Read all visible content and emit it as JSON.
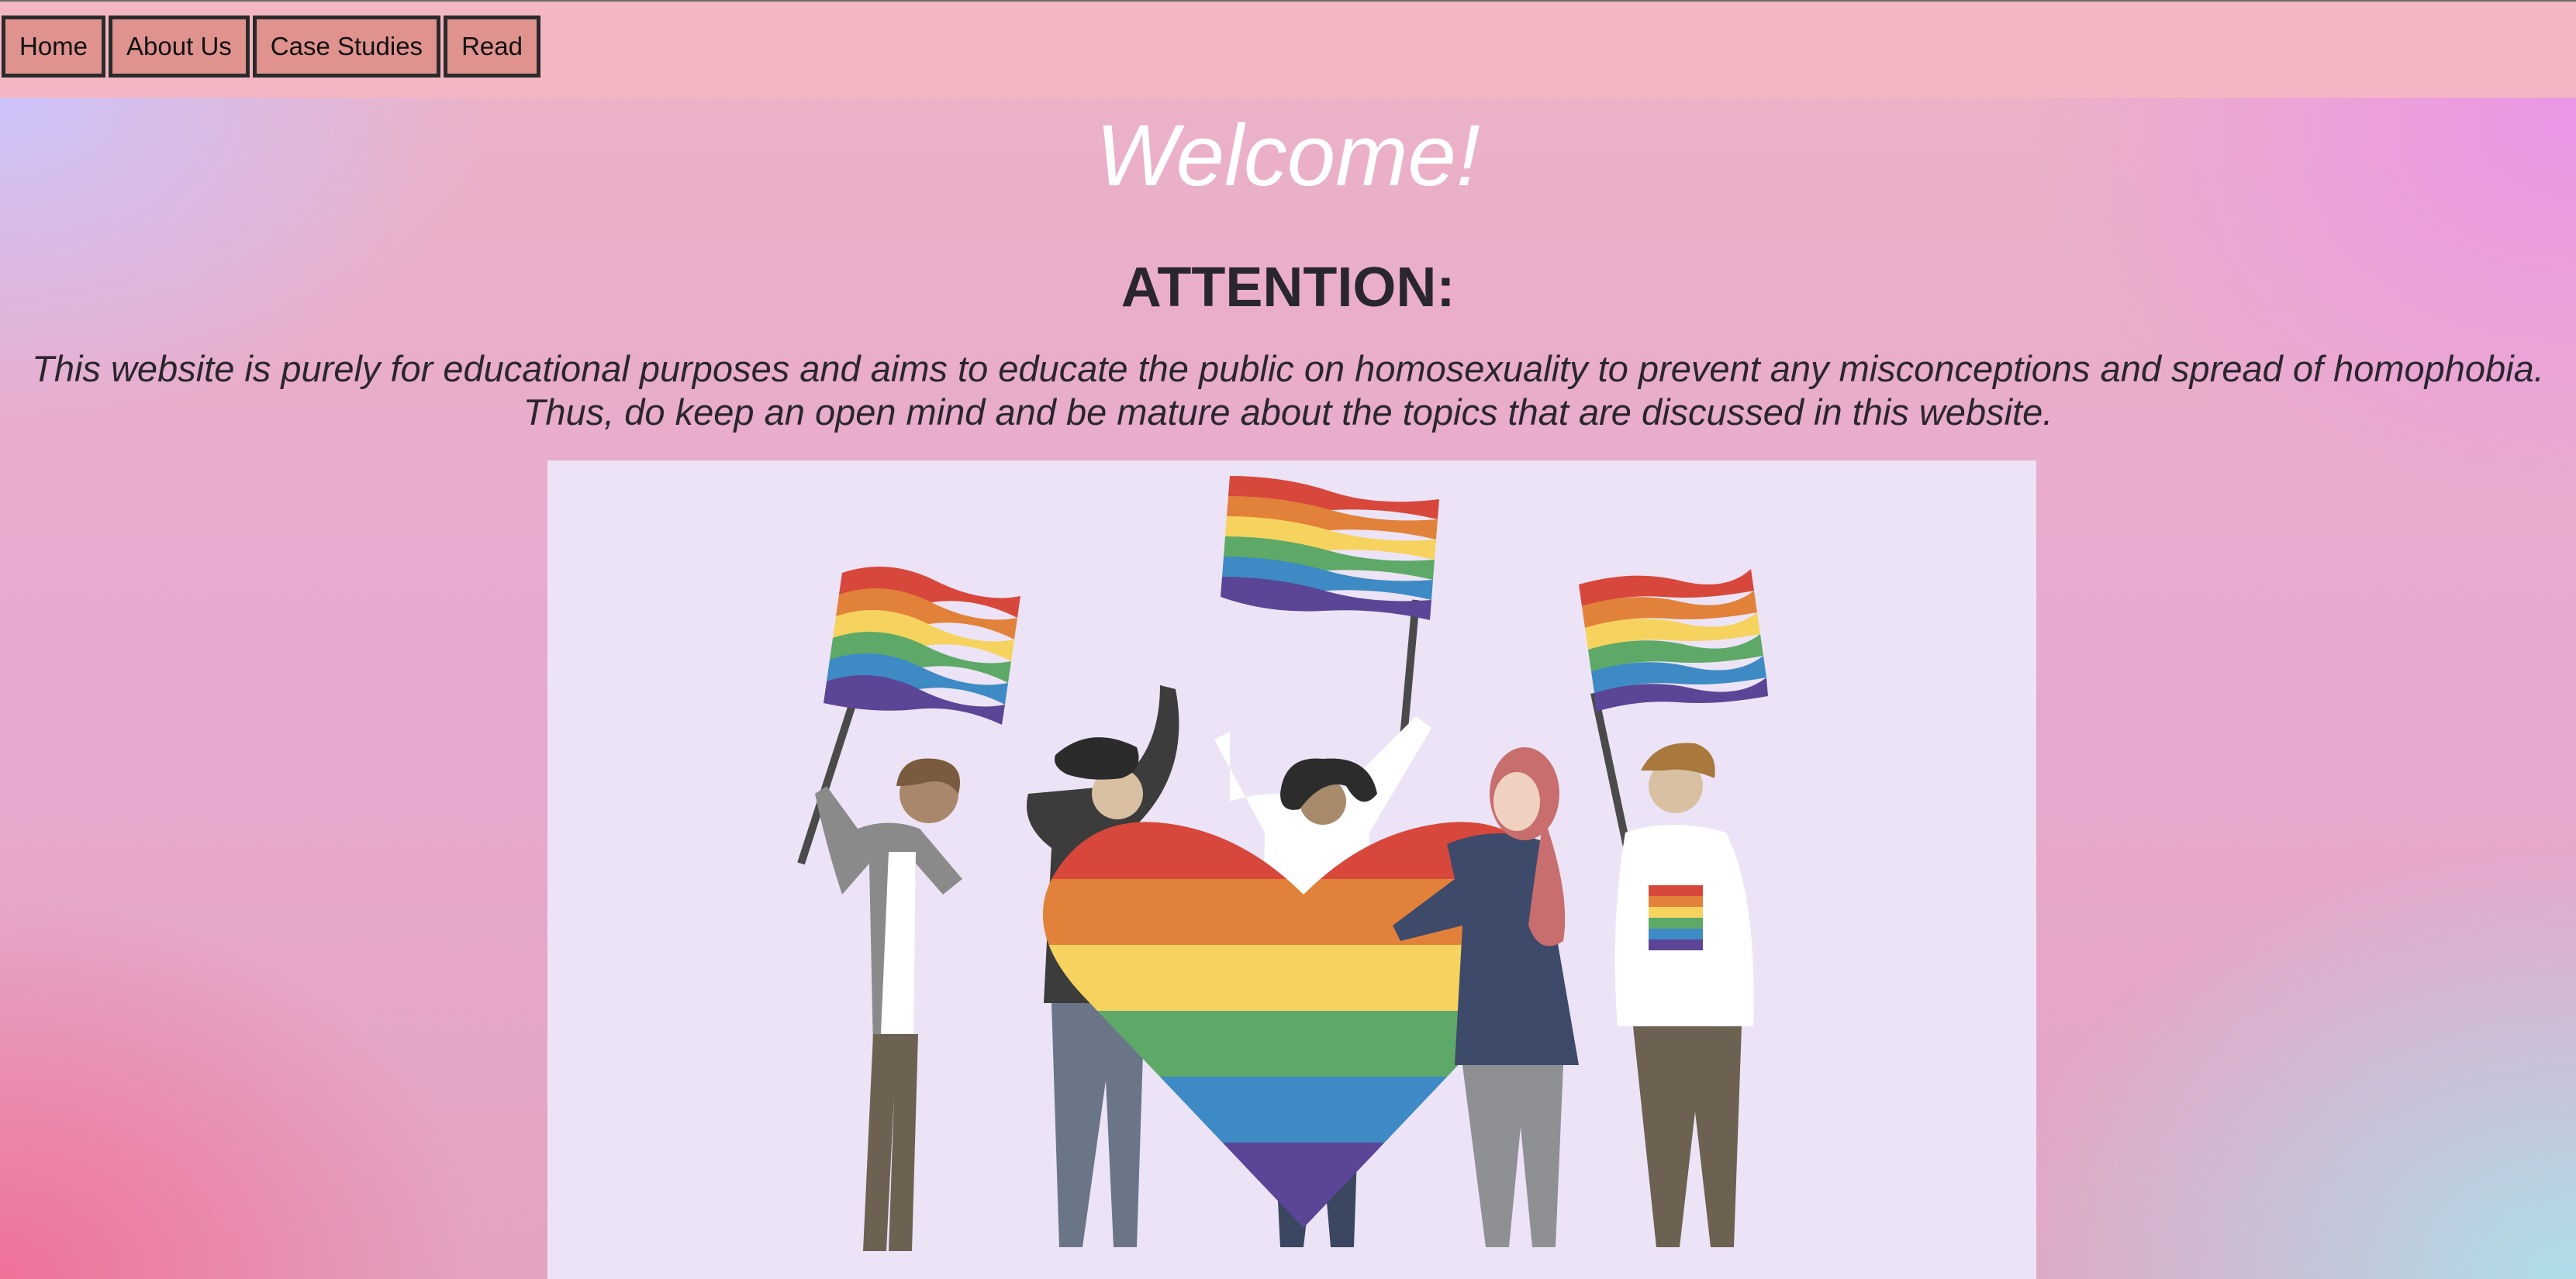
{
  "nav": {
    "items": [
      {
        "label": "Home"
      },
      {
        "label": "About Us"
      },
      {
        "label": "Case Studies"
      },
      {
        "label": "Read"
      }
    ]
  },
  "main": {
    "welcome": "Welcome!",
    "attention_heading": "ATTENTION:",
    "notice_line1": "This website is purely for educational purposes and aims to educate the public on homosexuality to prevent any misconceptions and spread of homophobia.",
    "notice_line2": "Thus, do keep an open mind and be mature about the topics that are discussed in this website."
  },
  "colors": {
    "navbar": "#f3b6c2",
    "nav_button": "#e0938e",
    "illustration_bg": "#ece4f6",
    "rainbow": [
      "#d8473b",
      "#e2823a",
      "#f6d35f",
      "#5ea868",
      "#3e8ac4",
      "#5b4596"
    ]
  },
  "illustration": {
    "icon": "pride-crowd-illustration"
  }
}
